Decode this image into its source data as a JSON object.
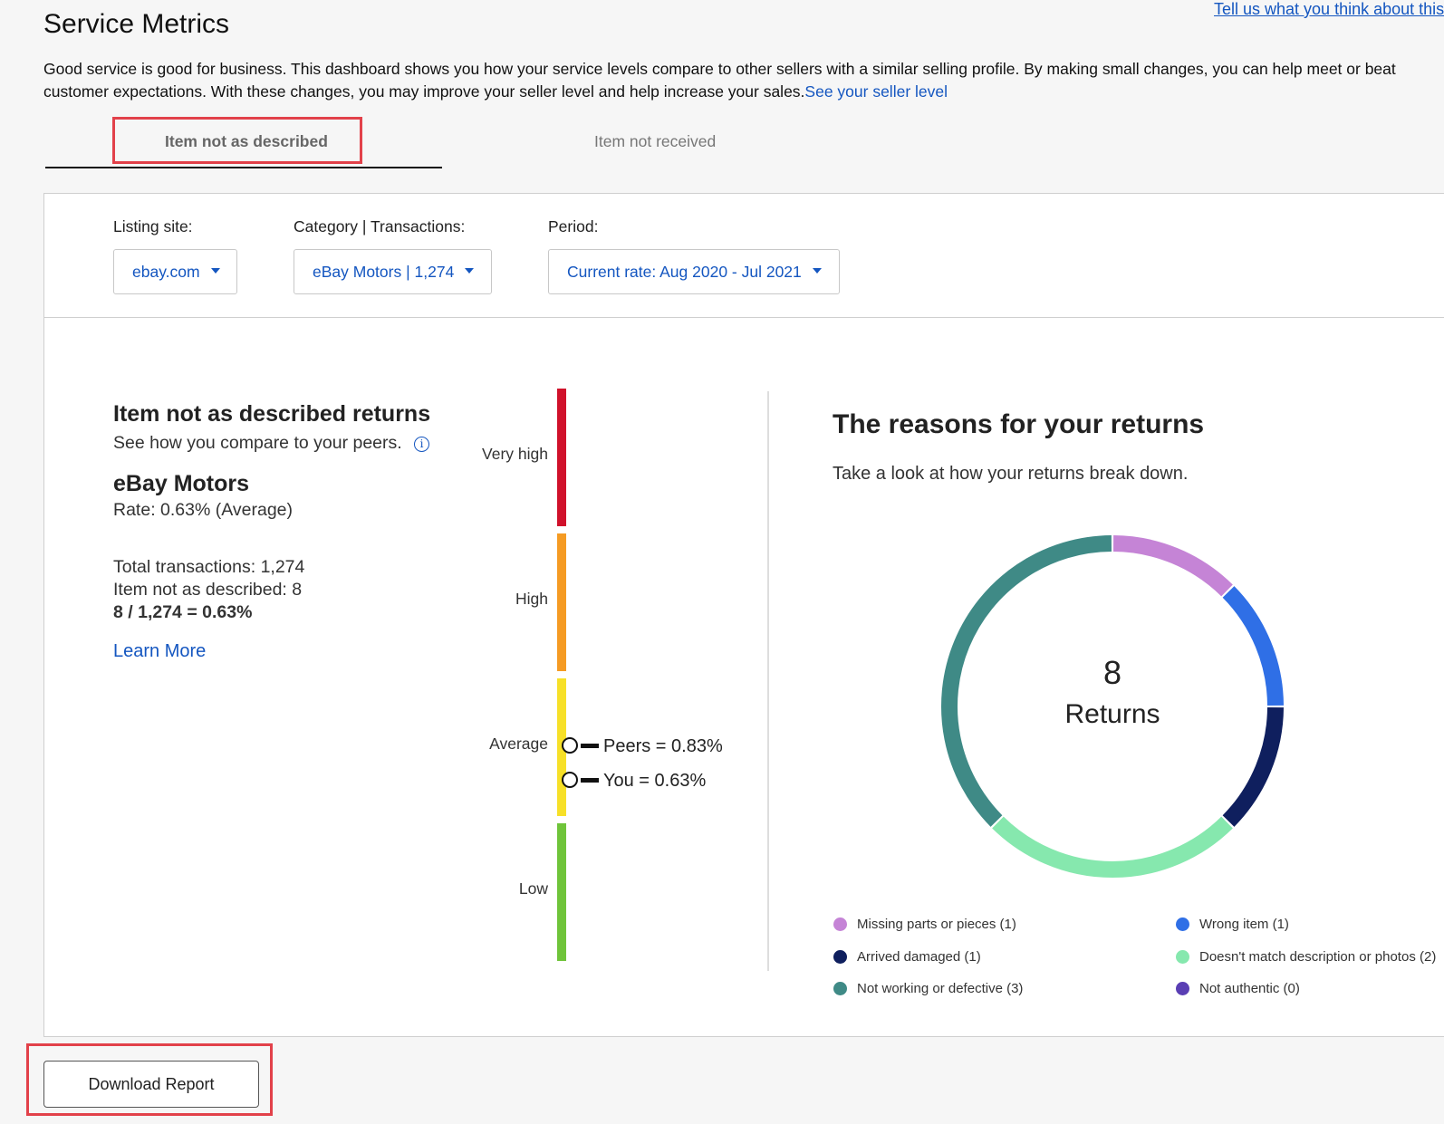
{
  "header": {
    "title": "Service Metrics",
    "feedback_link": "Tell us what you think about this p",
    "intro_text": "Good service is good for business. This dashboard shows you how your service levels compare to other sellers with a similar selling profile. By making small changes, you can help meet or beat customer expectations. With these changes, you may improve your seller level and help increase your sales.",
    "seller_level_link": "See your seller level"
  },
  "tabs": [
    {
      "label": "Item not as described",
      "selected": true
    },
    {
      "label": "Item not received",
      "selected": false
    }
  ],
  "filters": {
    "listing_site": {
      "label": "Listing site:",
      "value": "ebay.com"
    },
    "category": {
      "label": "Category | Transactions:",
      "value": "eBay Motors | 1,274"
    },
    "period": {
      "label": "Period:",
      "value": "Current rate: Aug 2020 - Jul 2021"
    }
  },
  "summary": {
    "title": "Item not as described returns",
    "subtitle": "See how you compare to your peers.",
    "category_name": "eBay Motors",
    "rate_text": "Rate: 0.63% (Average)",
    "total_transactions": "Total transactions: 1,274",
    "item_not_as_described": "Item not as described: 8",
    "formula": "8 / 1,274 = 0.63%",
    "learn_more": "Learn More"
  },
  "scale": {
    "levels": [
      {
        "label": "Very high",
        "color": "#d0112b"
      },
      {
        "label": "High",
        "color": "#f59b23"
      },
      {
        "label": "Average",
        "color": "#f7e028"
      },
      {
        "label": "Low",
        "color": "#6fc43a"
      }
    ],
    "peers_label": "Peers = 0.83%",
    "you_label": "You = 0.63%"
  },
  "reasons": {
    "title": "The reasons for your returns",
    "subtitle": "Take a look at how your returns break down.",
    "total": "8",
    "total_label": "Returns"
  },
  "chart_data": {
    "type": "pie",
    "categories": [
      "Missing parts or pieces",
      "Wrong item",
      "Arrived damaged",
      "Doesn't match description or photos",
      "Not working or defective",
      "Not authentic"
    ],
    "values": [
      1,
      1,
      1,
      2,
      3,
      0
    ],
    "colors": [
      "#c584d6",
      "#2f6fe6",
      "#0f1f5e",
      "#86e8ae",
      "#3f8a86",
      "#5a3fb4"
    ],
    "legend": [
      "Missing parts or pieces (1)",
      "Wrong item (1)",
      "Arrived damaged (1)",
      "Doesn't match description or photos (2)",
      "Not working or defective (3)",
      "Not authentic (0)"
    ]
  },
  "footer": {
    "download_label": "Download Report"
  }
}
